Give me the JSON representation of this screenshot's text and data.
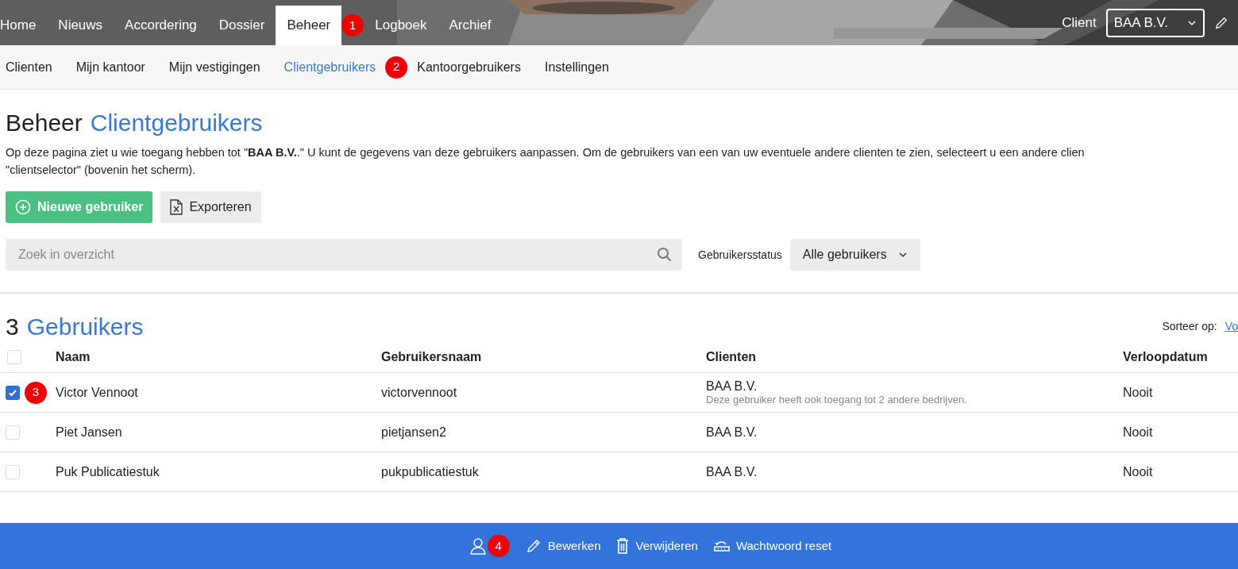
{
  "top_nav": {
    "items": [
      {
        "label": "Home",
        "selected": false
      },
      {
        "label": "Nieuws",
        "selected": false
      },
      {
        "label": "Accordering",
        "selected": false
      },
      {
        "label": "Dossier",
        "selected": false
      },
      {
        "label": "Beheer",
        "selected": true,
        "callout": "1"
      },
      {
        "label": "Logboek",
        "selected": false
      },
      {
        "label": "Archief",
        "selected": false
      }
    ],
    "client_label": "Client",
    "client_value": "BAA B.V."
  },
  "sub_nav": {
    "items": [
      {
        "label": "Clienten",
        "selected": false
      },
      {
        "label": "Mijn kantoor",
        "selected": false
      },
      {
        "label": "Mijn vestigingen",
        "selected": false
      },
      {
        "label": "Clientgebruikers",
        "selected": true,
        "callout": "2"
      },
      {
        "label": "Kantoorgebruikers",
        "selected": false
      },
      {
        "label": "Instellingen",
        "selected": false
      }
    ]
  },
  "page": {
    "title": "Beheer",
    "title_accent": "Clientgebruikers",
    "description": [
      "Op deze pagina ziet u wie toegang hebben tot \"**BAA B.V.**.\" U kunt de gegevens van deze gebruikers aanpassen. Om de gebruikers van een van uw eventuele andere clienten te zien, selecteert u een andere clien",
      "\"clientselector\" (bovenin het scherm)."
    ],
    "buttons": [
      {
        "label": "Nieuwe gebruiker",
        "kind": "primary"
      },
      {
        "label": "Exporteren",
        "kind": "export"
      }
    ],
    "search": {
      "placeholder": "Zoek in overzicht"
    },
    "status_filter": {
      "label": "Gebruikersstatus",
      "value": "Alle gebruikers"
    }
  },
  "list": {
    "count": "3",
    "title": "Gebruikers",
    "all_selected": false,
    "sort_label": "Sorteer op:",
    "sort_value": "Vo",
    "columns": [
      "Naam",
      "Gebruikersnaam",
      "Clienten",
      "Verloopdatum"
    ],
    "rows": [
      {
        "selected": true,
        "name": "Victor Vennoot",
        "username": "victorvennoot",
        "clients": "BAA B.V.",
        "note": "Deze gebruiker heeft ook toegang tot 2 andere bedrijven.",
        "expires": "Nooit",
        "callout": "3"
      },
      {
        "selected": false,
        "name": "Piet Jansen",
        "username": "pietjansen2",
        "clients": "BAA B.V.",
        "expires": "Nooit"
      },
      {
        "selected": false,
        "name": "Puk Publicatiestuk",
        "username": "pukpublicatiestuk",
        "clients": "BAA B.V.",
        "expires": "Nooit"
      }
    ]
  },
  "action_bar": {
    "callout": "4",
    "actions": [
      {
        "label": "Bewerken",
        "kind": "edit"
      },
      {
        "label": "Verwijderen",
        "kind": "delete"
      },
      {
        "label": "Wachtwoord reset",
        "kind": "reset"
      }
    ]
  }
}
